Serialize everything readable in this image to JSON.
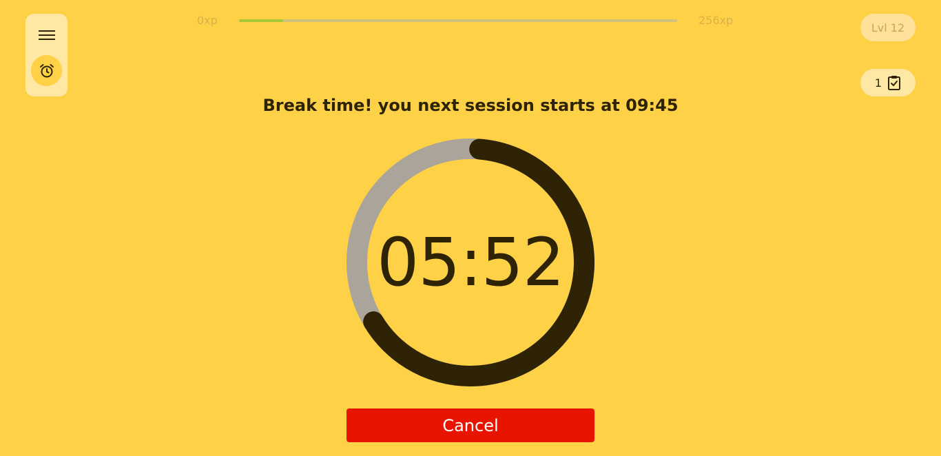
{
  "sidebar": {
    "menu_icon": "hamburger-icon",
    "timer_icon": "alarm-clock-icon"
  },
  "xp": {
    "min_label": "0xp",
    "max_label": "256xp",
    "progress": 0.1,
    "fill_color": "#a8c83a"
  },
  "level": {
    "label": "Lvl 12"
  },
  "tasks": {
    "count": "1",
    "icon": "clipboard-check-icon"
  },
  "headline": "Break time! you next session starts at 09:45",
  "timer": {
    "display": "05:52",
    "progress_remaining": 0.65,
    "ring_color": "#2e2304",
    "track_color": "#aaa49a"
  },
  "cancel_button": {
    "label": "Cancel",
    "color": "#e81400"
  },
  "colors": {
    "background": "#ffd147",
    "panel": "#ffe8a3"
  }
}
